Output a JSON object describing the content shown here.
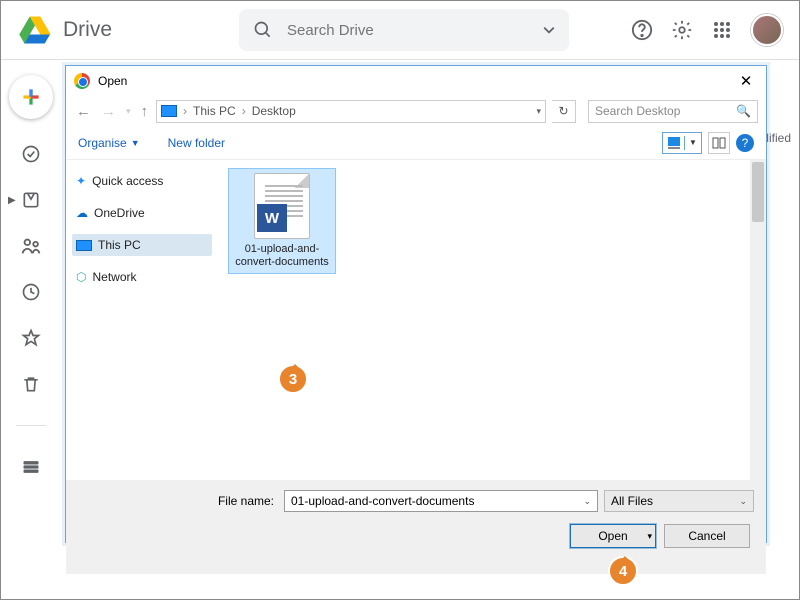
{
  "drive": {
    "app_name": "Drive",
    "search_placeholder": "Search Drive"
  },
  "column_modified": "odified",
  "dialog": {
    "title": "Open",
    "path": {
      "root": "This PC",
      "folder": "Desktop"
    },
    "search_placeholder": "Search Desktop",
    "organise": "Organise",
    "new_folder": "New folder",
    "tree": {
      "quick": "Quick access",
      "onedrive": "OneDrive",
      "thispc": "This PC",
      "network": "Network"
    },
    "file_label": "01-upload-and-convert-documents",
    "filename_label": "File name:",
    "filename_value": "01-upload-and-convert-documents",
    "filter": "All Files",
    "open_btn": "Open",
    "cancel_btn": "Cancel"
  },
  "callouts": {
    "step3": "3",
    "step4": "4"
  }
}
